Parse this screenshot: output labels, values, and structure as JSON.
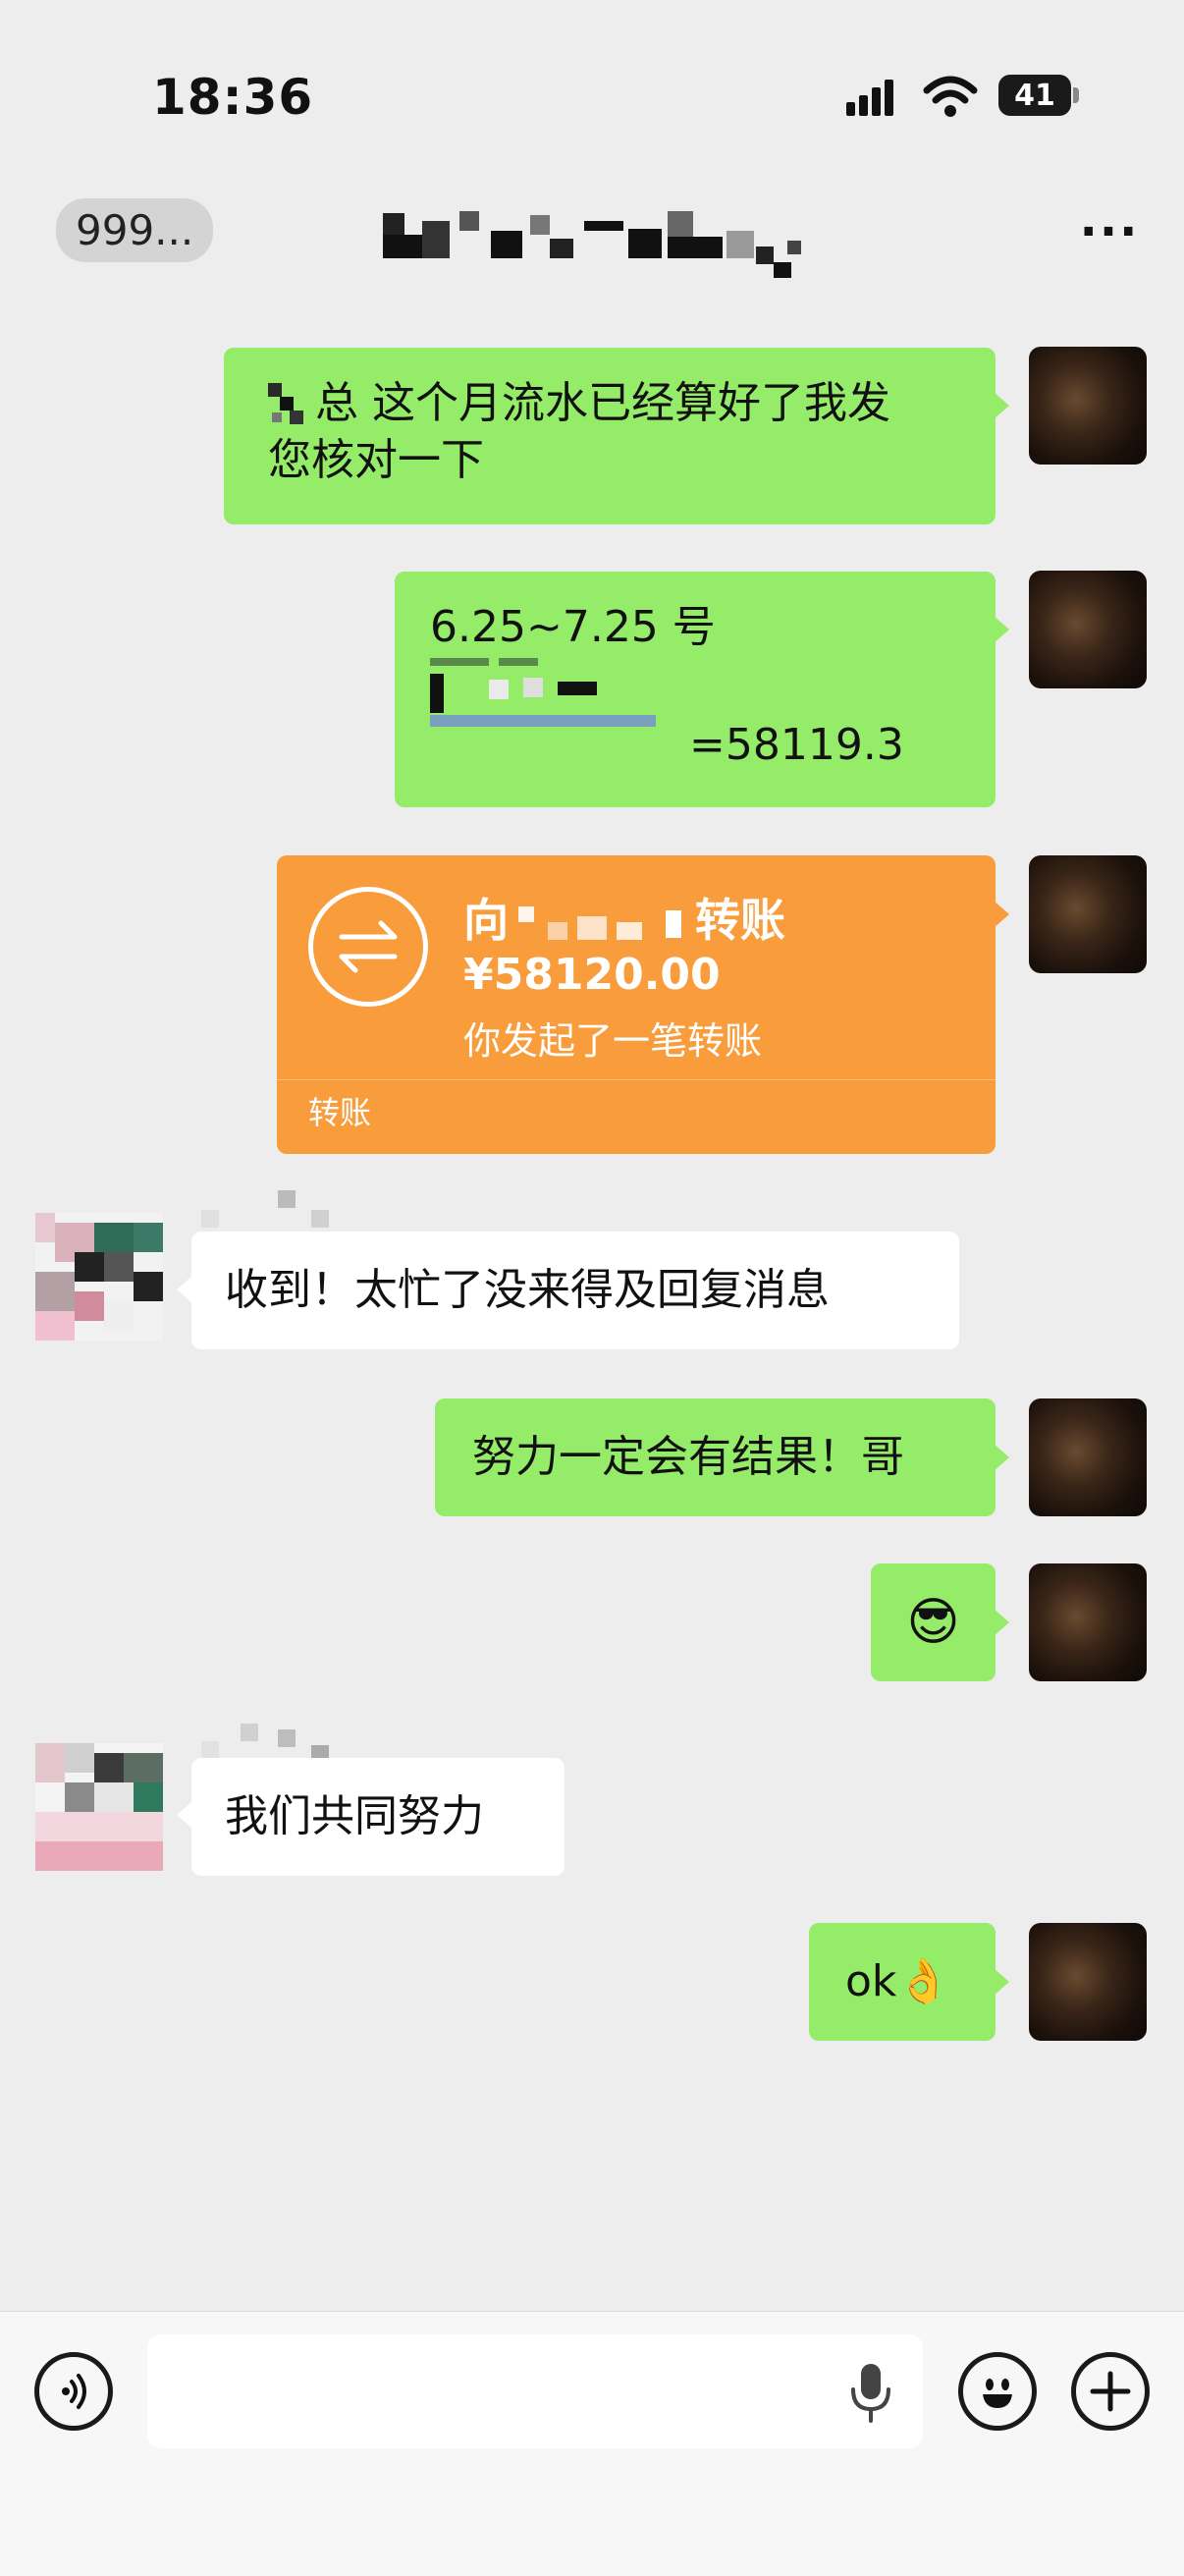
{
  "status_bar": {
    "time": "18:36",
    "battery": "41"
  },
  "nav": {
    "back_label": "999..."
  },
  "messages": [
    {
      "side": "right",
      "lines": [
        "总 这个月流水已经算好了我发",
        "您核对一下"
      ]
    },
    {
      "side": "right",
      "lines": [
        "6.25~7.25 号",
        "=58119.3"
      ]
    },
    {
      "side": "right",
      "type": "transfer",
      "prefix": "向",
      "suffix": "转账",
      "amount": "¥58120.00",
      "note": "你发起了一笔转账",
      "footer": "转账"
    },
    {
      "side": "left",
      "text": "收到！太忙了没来得及回复消息"
    },
    {
      "side": "right",
      "text": "努力一定会有结果！哥"
    },
    {
      "side": "right",
      "emoji": "😎"
    },
    {
      "side": "left",
      "text": "我们共同努力"
    },
    {
      "side": "right",
      "text": "ok",
      "emoji": "👌"
    }
  ],
  "icons": [
    "back-chevron-icon",
    "more-icon",
    "voice-icon",
    "mic-icon",
    "emoji-icon",
    "plus-icon",
    "transfer-icon",
    "signal-icon",
    "wifi-icon",
    "battery-icon"
  ],
  "colors": {
    "background": "#EDEDED",
    "self_bubble": "#95EC69",
    "other_bubble": "#FFFFFF",
    "transfer": "#F89C3C",
    "input_bar": "#F7F7F7"
  }
}
